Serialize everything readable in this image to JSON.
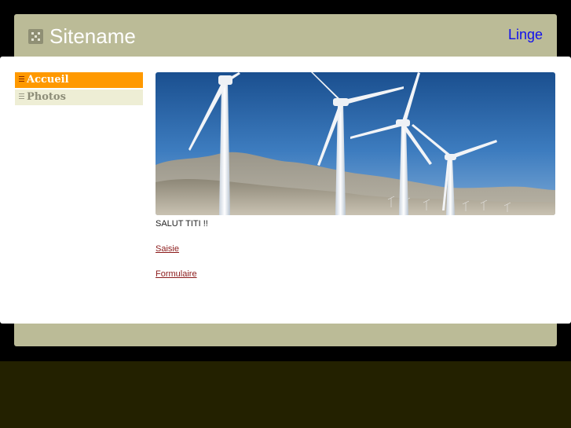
{
  "site": {
    "title": "Sitename",
    "top_link": "Linge",
    "logo_icon": "dice-icon"
  },
  "sidebar": {
    "items": [
      {
        "label": "Accueil",
        "active": true
      },
      {
        "label": "Photos",
        "active": false
      }
    ]
  },
  "main": {
    "hero_image": "wind-turbines-photo",
    "greeting": "SALUT TITI !!",
    "links": [
      {
        "label": "Saisie"
      },
      {
        "label": "Formulaire"
      }
    ]
  },
  "colors": {
    "page_background": "#000000",
    "bottom_band": "#232100",
    "frame": "#bbbb97",
    "nav_active": "#ff9900",
    "nav_inactive": "#eeeed5",
    "link": "#8b1a1a",
    "top_link": "#1010ee"
  }
}
